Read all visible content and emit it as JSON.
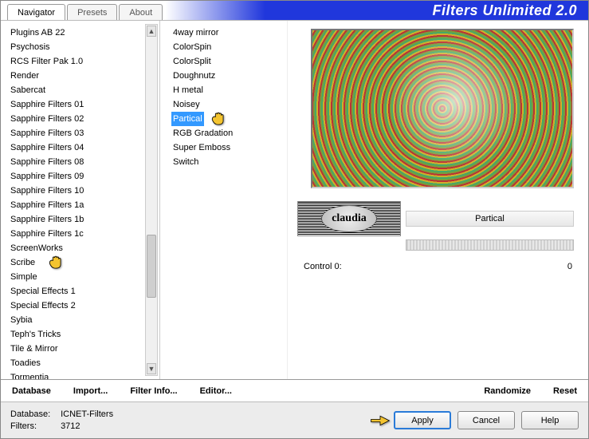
{
  "app": {
    "title": "Filters Unlimited 2.0"
  },
  "tabs": [
    {
      "label": "Navigator",
      "active": true
    },
    {
      "label": "Presets",
      "active": false
    },
    {
      "label": "About",
      "active": false
    }
  ],
  "categories": [
    "Plugins AB 22",
    "Psychosis",
    "RCS Filter Pak 1.0",
    "Render",
    "Sabercat",
    "Sapphire Filters 01",
    "Sapphire Filters 02",
    "Sapphire Filters 03",
    "Sapphire Filters 04",
    "Sapphire Filters 08",
    "Sapphire Filters 09",
    "Sapphire Filters 10",
    "Sapphire Filters 1a",
    "Sapphire Filters 1b",
    "Sapphire Filters 1c",
    "ScreenWorks",
    "Scribe",
    "Simple",
    "Special Effects 1",
    "Special Effects 2",
    "Sybia",
    "Teph's Tricks",
    "Tile & Mirror",
    "Toadies",
    "Tormentia"
  ],
  "category_pointer_index": 16,
  "filters": [
    "4way mirror",
    "ColorSpin",
    "ColorSplit",
    "Doughnutz",
    "H metal",
    "Noisey",
    "Partical",
    "RGB Gradation",
    "Super Emboss",
    "Switch"
  ],
  "filter_selected_index": 6,
  "selected_filter_name": "Partical",
  "control": {
    "label": "Control 0:",
    "value": "0"
  },
  "logo_text": "claudia",
  "toolbar": {
    "database": "Database",
    "import": "Import...",
    "filter_info": "Filter Info...",
    "editor": "Editor...",
    "randomize": "Randomize",
    "reset": "Reset"
  },
  "footer": {
    "db_label": "Database:",
    "db_value": "ICNET-Filters",
    "filters_label": "Filters:",
    "filters_value": "3712",
    "apply": "Apply",
    "cancel": "Cancel",
    "help": "Help"
  }
}
